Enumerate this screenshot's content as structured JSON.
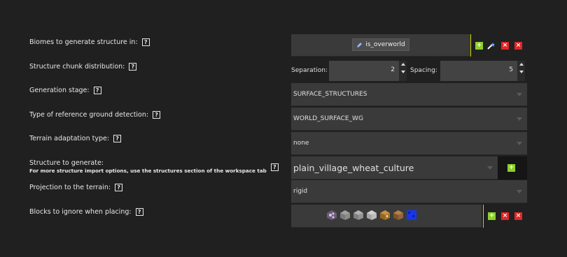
{
  "labels": {
    "biomes": "Biomes to generate structure in:",
    "distribution": "Structure chunk distribution:",
    "stage": "Generation stage:",
    "ground": "Type of reference ground detection:",
    "adaptation": "Terrain adaptation type:",
    "structure": "Structure to generate:",
    "structure_hint": "For more structure import options, use the structures section of the workspace tab",
    "projection": "Projection to the terrain:",
    "ignore_blocks": "Blocks to ignore when placing:"
  },
  "help_glyph": "?",
  "biomes": {
    "items": [
      "is_overworld"
    ]
  },
  "distribution": {
    "separation_label": "Separation:",
    "separation_value": "2",
    "spacing_label": "Spacing:",
    "spacing_value": "5"
  },
  "stage": {
    "value": "SURFACE_STRUCTURES"
  },
  "ground": {
    "value": "WORLD_SURFACE_WG"
  },
  "adaptation": {
    "value": "none"
  },
  "structure": {
    "value": "plain_village_wheat_culture"
  },
  "projection": {
    "value": "rigid"
  },
  "ignore_blocks": {
    "icons": [
      "structure-void-block-icon",
      "stone-block-icon",
      "stone-block-icon",
      "diorite-block-icon",
      "chest-block-icon",
      "crafting-table-block-icon",
      "blue-block-icon"
    ]
  },
  "buttons": {
    "add": "+",
    "remove": "×",
    "clear": "×"
  },
  "colors": {
    "accent_green": "#8dcf2b",
    "danger_red": "#e32626",
    "field_bg": "#3a3a3a",
    "background": "#202020",
    "divider": "#c8d400"
  }
}
